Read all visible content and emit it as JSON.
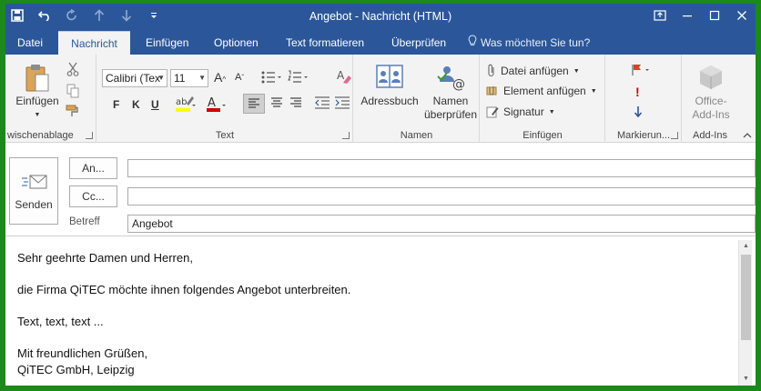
{
  "window": {
    "title": "Angebot - Nachricht (HTML)"
  },
  "tabs": [
    {
      "label": "Datei"
    },
    {
      "label": "Nachricht"
    },
    {
      "label": "Einfügen"
    },
    {
      "label": "Optionen"
    },
    {
      "label": "Text formatieren"
    },
    {
      "label": "Überprüfen"
    }
  ],
  "tellme": "Was möchten Sie tun?",
  "ribbon": {
    "clipboard": {
      "paste_label": "Einfügen",
      "group_label": "wischenablage"
    },
    "text": {
      "font": "Calibri (Tex",
      "size": "11",
      "bold": "F",
      "italic": "K",
      "underline": "U",
      "group_label": "Text"
    },
    "names": {
      "addressbook_label": "Adressbuch",
      "check_names_line1": "Namen",
      "check_names_line2": "überprüfen",
      "group_label": "Namen"
    },
    "insert": {
      "attach_file": "Datei anfügen",
      "attach_item": "Element anfügen",
      "signature": "Signatur",
      "group_label": "Einfügen"
    },
    "tags": {
      "group_label": "Markierun..."
    },
    "addins": {
      "line1": "Office-",
      "line2": "Add-Ins",
      "group_label": "Add-Ins"
    }
  },
  "compose": {
    "send_label": "Senden",
    "to_label": "An...",
    "cc_label": "Cc...",
    "to_value": "",
    "cc_value": "",
    "subject_label": "Betreff",
    "subject_value": "Angebot"
  },
  "body": {
    "greeting": "Sehr geehrte Damen und Herren,",
    "line1": "die Firma QiTEC möchte ihnen folgendes Angebot unterbreiten.",
    "line2": "Text, text, text ...",
    "closing": "Mit freundlichen Grüßen,",
    "signature": "QiTEC GmbH, Leipzig"
  },
  "colors": {
    "accent": "#2b579a",
    "border": "#1b8a1b",
    "highlight": "#ffff00",
    "font_color": "#d00000"
  }
}
